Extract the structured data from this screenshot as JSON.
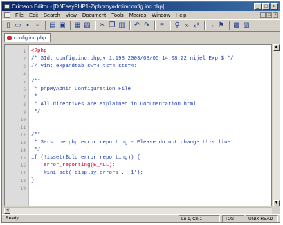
{
  "window": {
    "title": "Crimson Editor - [D:\\EasyPHP1-7\\phpmyadmin\\config.inc.php]"
  },
  "menu": [
    "File",
    "Edit",
    "Search",
    "View",
    "Document",
    "Tools",
    "Macros",
    "Window",
    "Help"
  ],
  "toolbar": [
    "new-file-icon",
    "open-folder-icon",
    "save-icon",
    "save-all-icon",
    "sep",
    "open-icon",
    "save-disk-icon",
    "sep",
    "print-icon",
    "print-preview-icon",
    "sep",
    "cut-icon",
    "copy-icon",
    "paste-icon",
    "sep",
    "undo-icon",
    "redo-icon",
    "sep",
    "list-icon",
    "sep",
    "find-icon",
    "find-next-icon",
    "replace-icon",
    "sep",
    "goto-icon",
    "bookmark-icon",
    "sep",
    "toggle-icon",
    "view-icon"
  ],
  "tab": {
    "label": "config.inc.php"
  },
  "editor": {
    "lines": [
      {
        "n": "1",
        "text": "<?php",
        "kind": "tag"
      },
      {
        "n": "2",
        "text": "/* $Id: config.inc.php,v 1.198 2003/08/05 14:08:22 nijel Exp $ */",
        "kind": "comment"
      },
      {
        "n": "3",
        "text": "// vim: expandtab sw=4 ts=4 sts=4:",
        "kind": "comment"
      },
      {
        "n": "4",
        "text": "",
        "kind": "comment"
      },
      {
        "n": "5",
        "text": "/**",
        "kind": "comment"
      },
      {
        "n": "6",
        "text": " * phpMyAdmin Configuration File",
        "kind": "comment"
      },
      {
        "n": "7",
        "text": " *",
        "kind": "comment"
      },
      {
        "n": "8",
        "text": " * All directives are explained in Documentation.html",
        "kind": "comment"
      },
      {
        "n": "9",
        "text": " */",
        "kind": "comment"
      },
      {
        "n": "10",
        "text": "",
        "kind": "comment"
      },
      {
        "n": "11",
        "text": "",
        "kind": "comment"
      },
      {
        "n": "12",
        "text": "/**",
        "kind": "comment"
      },
      {
        "n": "13",
        "text": " * Sets the php error reporting - Please do not change this line!",
        "kind": "comment"
      },
      {
        "n": "14",
        "text": " */",
        "kind": "comment"
      },
      {
        "n": "15",
        "text": "if (!isset($old_error_reporting)) {",
        "kind": "code"
      },
      {
        "n": "16",
        "text": "    error_reporting(E_ALL);",
        "kind": "err"
      },
      {
        "n": "17",
        "text": "    @ini_set('display_errors', '1');",
        "kind": "code"
      },
      {
        "n": "18",
        "text": "}",
        "kind": "code"
      },
      {
        "n": "19",
        "text": "",
        "kind": "code"
      }
    ]
  },
  "status": {
    "left": "Ready",
    "position": "Ln 1, Ch 1",
    "flags": "TOS",
    "mode": "UNIX READ"
  }
}
